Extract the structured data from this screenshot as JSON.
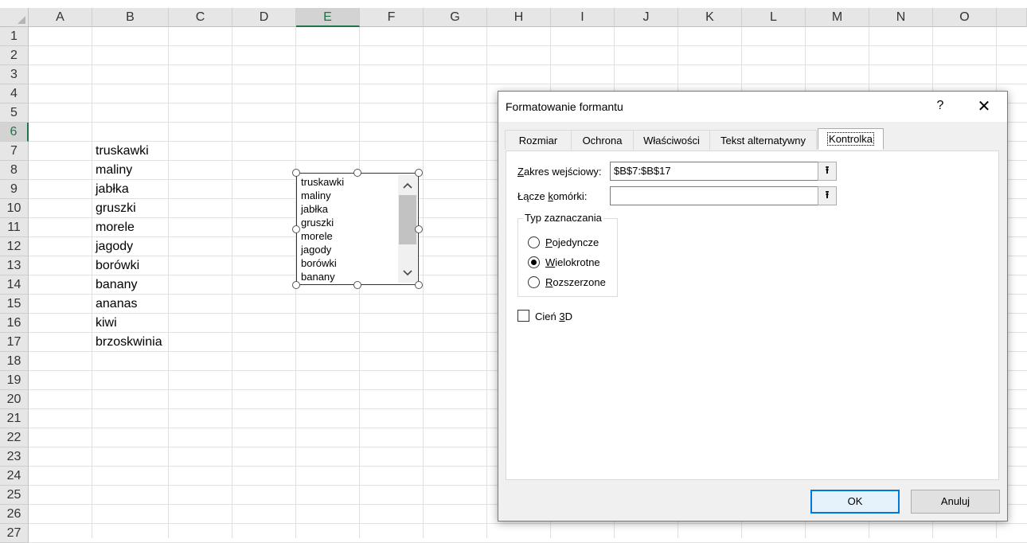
{
  "sheet": {
    "columns": [
      "A",
      "B",
      "C",
      "D",
      "E",
      "F",
      "G",
      "H",
      "I",
      "J",
      "K",
      "L",
      "M",
      "N",
      "O"
    ],
    "selected_column": "E",
    "rows": [
      "1",
      "2",
      "3",
      "4",
      "5",
      "6",
      "7",
      "8",
      "9",
      "10",
      "11",
      "12",
      "13",
      "14",
      "15",
      "16",
      "17",
      "18",
      "19",
      "20",
      "21",
      "22",
      "23",
      "24",
      "25",
      "26",
      "27"
    ],
    "selected_row": "6",
    "column_b_values": [
      "truskawki",
      "maliny",
      "jabłka",
      "gruszki",
      "morele",
      "jagody",
      "borówki",
      "banany",
      "ananas",
      "kiwi",
      "brzoskwinia"
    ]
  },
  "listbox": {
    "items": [
      "truskawki",
      "maliny",
      "jabłka",
      "gruszki",
      "morele",
      "jagody",
      "borówki",
      "banany"
    ],
    "scroll_up_icon": "chevron-up-icon",
    "scroll_down_icon": "chevron-down-icon"
  },
  "dialog": {
    "title": "Formatowanie formantu",
    "help": "?",
    "close": "✕",
    "tabs": [
      "Rozmiar",
      "Ochrona",
      "Właściwości",
      "Tekst alternatywny",
      "Kontrolka"
    ],
    "active_tab": "Kontrolka",
    "input_range_label_u": "Z",
    "input_range_label_rest": "akres wejściowy:",
    "input_range_value": "$B$7:$B$17",
    "cell_link_label_pre": "Łącze ",
    "cell_link_label_u": "k",
    "cell_link_label_rest": "omórki:",
    "cell_link_value": "",
    "collapse_icon": "⭱",
    "selection_type_title": "Typ zaznaczania",
    "radio_single_u": "P",
    "radio_single_rest": "ojedyncze",
    "radio_multi_u": "W",
    "radio_multi_rest": "ielokrotne",
    "radio_extended_u": "R",
    "radio_extended_rest": "ozszerzone",
    "selected_option": "Wielokrotne",
    "shadow_label_pre": "Cień ",
    "shadow_label_u": "3",
    "shadow_label_rest": "D",
    "shadow_checked": false,
    "ok_label": "OK",
    "cancel_label": "Anuluj"
  }
}
